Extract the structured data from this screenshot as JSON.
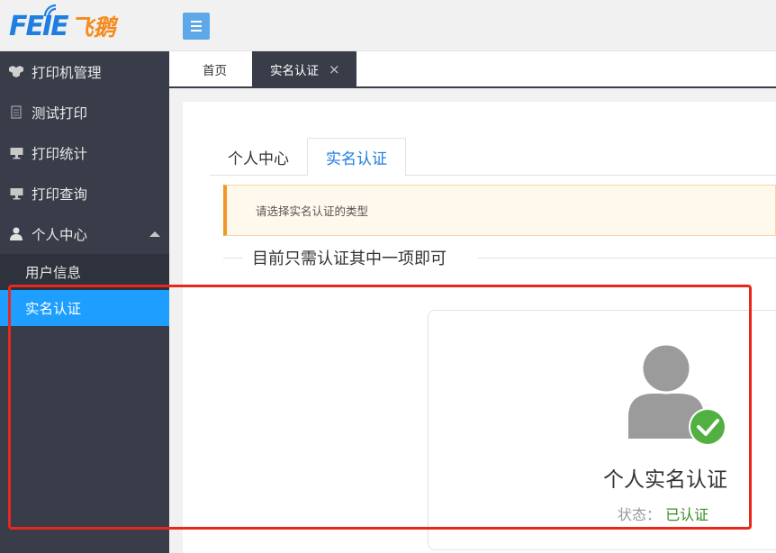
{
  "logo": {
    "en": "FEIE",
    "cn": "飞鹅"
  },
  "sidebar": {
    "items": [
      {
        "label": "打印机管理",
        "icon": "cubes-icon"
      },
      {
        "label": "测试打印",
        "icon": "document-icon"
      },
      {
        "label": "打印统计",
        "icon": "monitor-icon"
      },
      {
        "label": "打印查询",
        "icon": "monitor-icon"
      },
      {
        "label": "个人中心",
        "icon": "user-icon"
      }
    ],
    "subitems": [
      {
        "label": "用户信息"
      },
      {
        "label": "实名认证",
        "active": true
      }
    ]
  },
  "tabs": [
    {
      "label": "首页"
    },
    {
      "label": "实名认证",
      "active": true,
      "close": "×"
    }
  ],
  "inner_tabs": [
    {
      "label": "个人中心"
    },
    {
      "label": "实名认证",
      "active": true
    }
  ],
  "tip": "请选择实名认证的类型",
  "section_title": "目前只需认证其中一项即可",
  "card": {
    "title": "个人实名认证",
    "status_label": "状态：",
    "status_value": "已认证"
  },
  "colors": {
    "sidebar_bg": "#393d49",
    "active_blue": "#1e9fff",
    "verified_green": "#52b043",
    "highlight_red": "#e8271d",
    "tip_border": "#f19725"
  }
}
